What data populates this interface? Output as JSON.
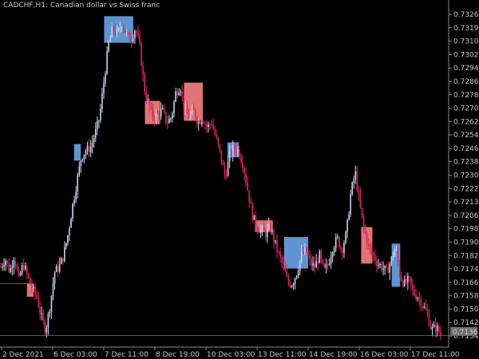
{
  "window": {
    "title": "CADCHF,H1:  Canadian dollar vs Swiss franc"
  },
  "colors": {
    "background": "#000000",
    "axis": "#8a8a8a",
    "text": "#c8c8c8",
    "bull": "#c7d2ea",
    "bear": "#e0245e",
    "zone_blue": "#5e95d1",
    "zone_red": "#e07373",
    "price_label_bg": "#6e6e6e",
    "level_line": "#e0245e",
    "current_line": "#8a8a8a"
  },
  "chart_data": {
    "type": "candlestick",
    "symbol": "CADCHF",
    "timeframe": "H1",
    "description": "Canadian dollar vs Swiss franc",
    "ylim": [
      0.7135,
      0.7333
    ],
    "y_ticks": [
      "0.73260",
      "0.73190",
      "0.73100",
      "0.73020",
      "0.72940",
      "0.72860",
      "0.72780",
      "0.72700",
      "0.72620",
      "0.72540",
      "0.72460",
      "0.72380",
      "0.72300",
      "0.72220",
      "0.72130",
      "0.72060",
      "0.71980",
      "0.71900",
      "0.71820",
      "0.71740",
      "0.71660",
      "0.71580",
      "0.71500",
      "0.71420",
      "0.71340"
    ],
    "x_ticks": [
      "2 Dec 2021",
      "6 Dec 03:00",
      "7 Dec 11:00",
      "8 Dec 19:00",
      "10 Dec 03:00",
      "13 Dec 11:00",
      "14 Dec 19:00",
      "16 Dec 03:00",
      "17 Dec 11:00"
    ],
    "current_price": "0.71367",
    "current_price_value": 0.71367,
    "level_line_value": 0.7168,
    "close_path": [
      [
        0,
        0.7178
      ],
      [
        0.01,
        0.7183
      ],
      [
        0.02,
        0.7175
      ],
      [
        0.03,
        0.7185
      ],
      [
        0.04,
        0.717
      ],
      [
        0.05,
        0.718
      ],
      [
        0.06,
        0.7172
      ],
      [
        0.07,
        0.7165
      ],
      [
        0.08,
        0.716
      ],
      [
        0.09,
        0.7148
      ],
      [
        0.1,
        0.714
      ],
      [
        0.11,
        0.7155
      ],
      [
        0.12,
        0.7175
      ],
      [
        0.13,
        0.7178
      ],
      [
        0.14,
        0.7185
      ],
      [
        0.15,
        0.7198
      ],
      [
        0.16,
        0.7215
      ],
      [
        0.17,
        0.723
      ],
      [
        0.18,
        0.7245
      ],
      [
        0.19,
        0.7248
      ],
      [
        0.2,
        0.725
      ],
      [
        0.21,
        0.7258
      ],
      [
        0.22,
        0.7268
      ],
      [
        0.23,
        0.729
      ],
      [
        0.24,
        0.7312
      ],
      [
        0.25,
        0.7322
      ],
      [
        0.26,
        0.7318
      ],
      [
        0.27,
        0.7325
      ],
      [
        0.28,
        0.7318
      ],
      [
        0.29,
        0.7315
      ],
      [
        0.3,
        0.7322
      ],
      [
        0.31,
        0.731
      ],
      [
        0.32,
        0.7285
      ],
      [
        0.33,
        0.7275
      ],
      [
        0.34,
        0.7268
      ],
      [
        0.35,
        0.727
      ],
      [
        0.36,
        0.7272
      ],
      [
        0.37,
        0.7265
      ],
      [
        0.38,
        0.7268
      ],
      [
        0.39,
        0.7283
      ],
      [
        0.4,
        0.7287
      ],
      [
        0.41,
        0.7272
      ],
      [
        0.42,
        0.7268
      ],
      [
        0.43,
        0.7272
      ],
      [
        0.44,
        0.7265
      ],
      [
        0.45,
        0.7268
      ],
      [
        0.46,
        0.7262
      ],
      [
        0.47,
        0.7265
      ],
      [
        0.48,
        0.7255
      ],
      [
        0.49,
        0.7245
      ],
      [
        0.5,
        0.7232
      ],
      [
        0.51,
        0.7245
      ],
      [
        0.52,
        0.725
      ],
      [
        0.53,
        0.7248
      ],
      [
        0.54,
        0.724
      ],
      [
        0.55,
        0.7225
      ],
      [
        0.56,
        0.721
      ],
      [
        0.57,
        0.7202
      ],
      [
        0.58,
        0.72
      ],
      [
        0.59,
        0.7198
      ],
      [
        0.6,
        0.7202
      ],
      [
        0.61,
        0.7193
      ],
      [
        0.62,
        0.7185
      ],
      [
        0.63,
        0.7178
      ],
      [
        0.64,
        0.7168
      ],
      [
        0.65,
        0.7168
      ],
      [
        0.66,
        0.7175
      ],
      [
        0.67,
        0.7185
      ],
      [
        0.68,
        0.7188
      ],
      [
        0.69,
        0.718
      ],
      [
        0.7,
        0.7178
      ],
      [
        0.71,
        0.7185
      ],
      [
        0.72,
        0.7175
      ],
      [
        0.73,
        0.718
      ],
      [
        0.74,
        0.719
      ],
      [
        0.75,
        0.7195
      ],
      [
        0.76,
        0.7188
      ],
      [
        0.77,
        0.7198
      ],
      [
        0.78,
        0.7222
      ],
      [
        0.79,
        0.7235
      ],
      [
        0.8,
        0.7215
      ],
      [
        0.81,
        0.72
      ],
      [
        0.82,
        0.719
      ],
      [
        0.83,
        0.7185
      ],
      [
        0.84,
        0.718
      ],
      [
        0.85,
        0.7178
      ],
      [
        0.86,
        0.7175
      ],
      [
        0.87,
        0.7182
      ],
      [
        0.88,
        0.719
      ],
      [
        0.89,
        0.7172
      ],
      [
        0.9,
        0.7168
      ],
      [
        0.91,
        0.717
      ],
      [
        0.92,
        0.7162
      ],
      [
        0.93,
        0.716
      ],
      [
        0.94,
        0.7155
      ],
      [
        0.95,
        0.715
      ],
      [
        0.96,
        0.714
      ],
      [
        0.97,
        0.7142
      ],
      [
        0.98,
        0.7137
      ]
    ],
    "zones": [
      {
        "color": "blue",
        "x0": 0.165,
        "x1": 0.18,
        "y0": 0.7242,
        "y1": 0.7252
      },
      {
        "color": "blue",
        "x0": 0.232,
        "x1": 0.297,
        "y0": 0.7313,
        "y1": 0.7329
      },
      {
        "color": "red",
        "x0": 0.323,
        "x1": 0.357,
        "y0": 0.7264,
        "y1": 0.7278
      },
      {
        "color": "red",
        "x0": 0.41,
        "x1": 0.452,
        "y0": 0.7266,
        "y1": 0.7289
      },
      {
        "color": "blue",
        "x0": 0.507,
        "x1": 0.532,
        "y0": 0.7244,
        "y1": 0.7253
      },
      {
        "color": "red",
        "x0": 0.568,
        "x1": 0.608,
        "y0": 0.7199,
        "y1": 0.7206
      },
      {
        "color": "blue",
        "x0": 0.633,
        "x1": 0.687,
        "y0": 0.7177,
        "y1": 0.7196
      },
      {
        "color": "red",
        "x0": 0.805,
        "x1": 0.83,
        "y0": 0.718,
        "y1": 0.7202
      },
      {
        "color": "blue",
        "x0": 0.873,
        "x1": 0.892,
        "y0": 0.7166,
        "y1": 0.7192
      },
      {
        "color": "red",
        "x0": 0.06,
        "x1": 0.075,
        "y0": 0.716,
        "y1": 0.7168
      }
    ]
  }
}
